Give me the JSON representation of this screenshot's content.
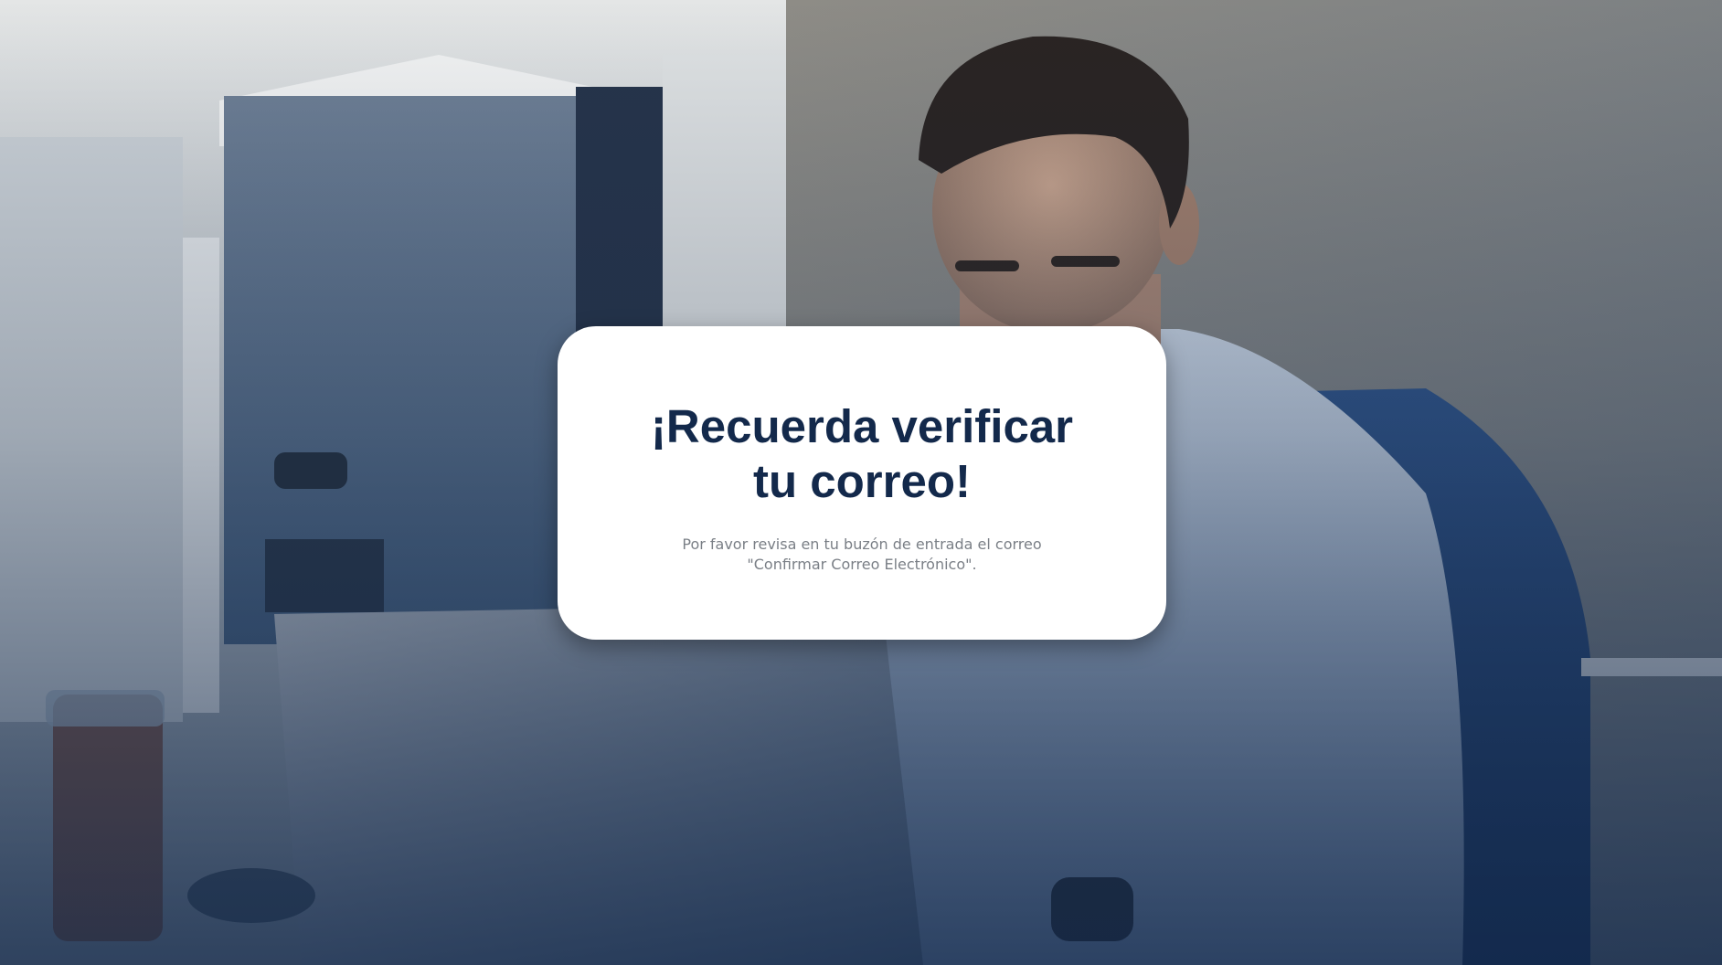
{
  "background": {
    "image": "office-man-laptop-photo",
    "overlay_color": "#102648"
  },
  "modal": {
    "title": "¡Recuerda verificar\ntu correo!",
    "message": "Por favor revisa en tu buzón de entrada el correo\n\"Confirmar Correo Electrónico\".",
    "title_color": "#13294b",
    "message_color": "#7a7f86"
  }
}
